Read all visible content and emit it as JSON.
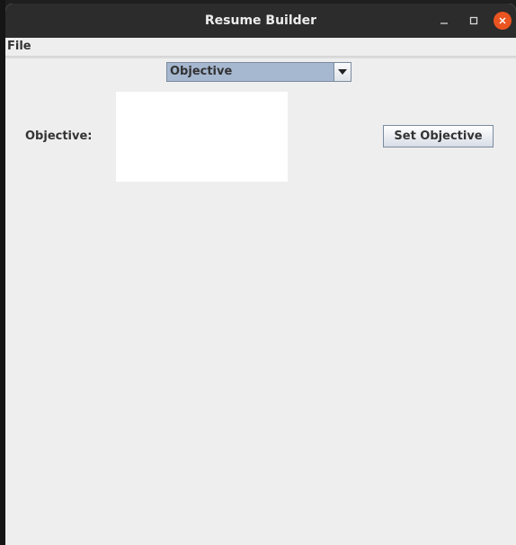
{
  "window": {
    "title": "Resume Builder",
    "controls": {
      "minimize_icon": "minimize-icon",
      "maximize_icon": "maximize-icon",
      "close_icon": "close-icon",
      "close_color": "#e95420"
    }
  },
  "menubar": {
    "items": [
      {
        "label": "File"
      }
    ]
  },
  "section_selector": {
    "selected": "Objective",
    "arrow_icon": "dropdown-arrow-icon"
  },
  "form": {
    "objective_label": "Objective:",
    "objective_value": "",
    "set_button_label": "Set Objective"
  },
  "colors": {
    "titlebar": "#2c2c2c",
    "window_bg": "#eeeeee",
    "combo_bg": "#a6b7d0"
  }
}
